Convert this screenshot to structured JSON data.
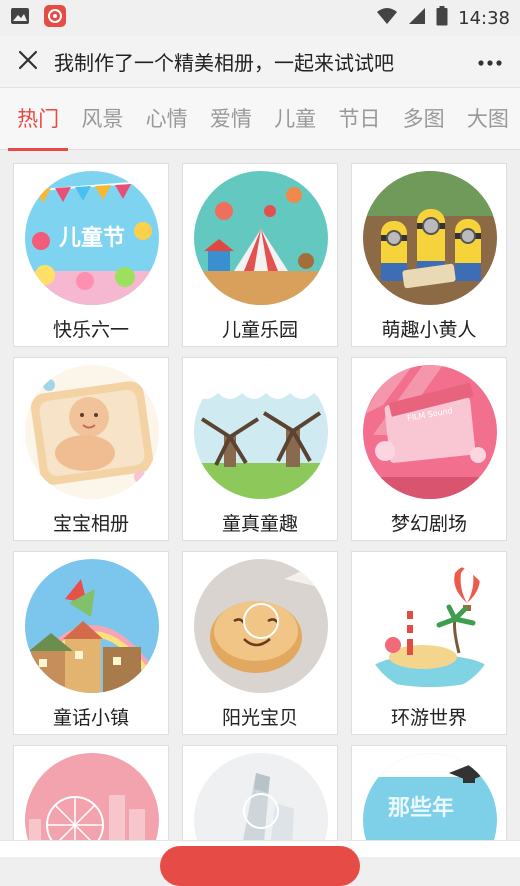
{
  "status_bar": {
    "time": "14:38",
    "icons": [
      "image-icon",
      "app-icon",
      "wifi-icon",
      "signal-icon",
      "battery-icon"
    ]
  },
  "header": {
    "title": "我制作了一个精美相册，一起来试试吧",
    "close_icon": "close-icon",
    "more_icon": "more-icon"
  },
  "tabs": [
    {
      "label": "热门",
      "active": true
    },
    {
      "label": "风景",
      "active": false
    },
    {
      "label": "心情",
      "active": false
    },
    {
      "label": "爱情",
      "active": false
    },
    {
      "label": "儿童",
      "active": false
    },
    {
      "label": "节日",
      "active": false
    },
    {
      "label": "多图",
      "active": false
    },
    {
      "label": "大图",
      "active": false
    }
  ],
  "albums": [
    {
      "title": "快乐六一"
    },
    {
      "title": "儿童乐园"
    },
    {
      "title": "萌趣小黄人"
    },
    {
      "title": "宝宝相册"
    },
    {
      "title": "童真童趣"
    },
    {
      "title": "梦幻剧场"
    },
    {
      "title": "童话小镇"
    },
    {
      "title": "阳光宝贝"
    },
    {
      "title": "环游世界"
    },
    {
      "title": ""
    },
    {
      "title": ""
    },
    {
      "title": ""
    }
  ],
  "thumb_text": {
    "children_day": "儿童节",
    "theater": "FILM  Sound",
    "graduation": "那些年"
  },
  "colors": {
    "accent": "#e74b45",
    "tab_inactive": "#999999"
  }
}
